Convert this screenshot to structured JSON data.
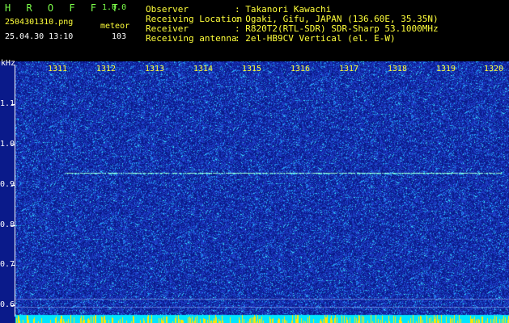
{
  "header": {
    "app_title": "H R O F F T",
    "app_version": "1.0.0",
    "file_name": "2504301310.png",
    "mode": "meteor",
    "datetime": "25.04.30 13:10",
    "count": "103",
    "info": [
      {
        "key": "Observer",
        "value": ": Takanori Kawachi"
      },
      {
        "key": "Receiving Location",
        "value": ": Ogaki, Gifu, JAPAN (136.60E, 35.35N)"
      },
      {
        "key": "Receiver",
        "value": ": R820T2(RTL-SDR) SDR-Sharp 53.1000MHz"
      },
      {
        "key": "Receiving antenna",
        "value": ": 2el-HB9CV Vertical (el. E-W)"
      }
    ]
  },
  "spectrogram": {
    "y_unit": "kHz",
    "y_ticks": [
      "1.1",
      "1.0",
      "0.9",
      "0.8",
      "0.7",
      "0.6"
    ],
    "x_ticks": [
      "1311",
      "1312",
      "1313",
      "1314",
      "1315",
      "1316",
      "1317",
      "1318",
      "1319",
      "1320"
    ],
    "colors": {
      "background": "#0a1a8a",
      "noise_low": "#1f3ec8",
      "noise_mid": "#21a8ff",
      "noise_high": "#3df5ff",
      "signal": "#9fffd6",
      "bottom_band": "#00e5ff",
      "bottom_spikes": "#ffe600"
    }
  }
}
